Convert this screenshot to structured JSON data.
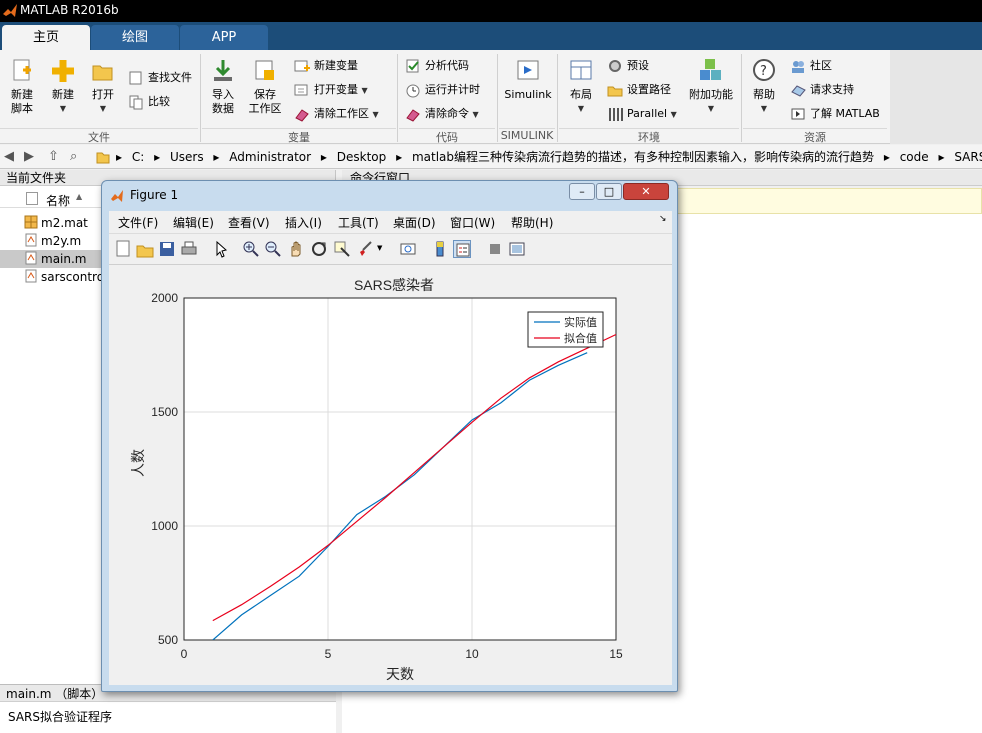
{
  "app": {
    "title": "MATLAB R2016b"
  },
  "tabs": [
    {
      "label": "主页"
    },
    {
      "label": "绘图"
    },
    {
      "label": "APP"
    }
  ],
  "ribbon": {
    "file": {
      "section": "文件",
      "new_script": "新建\n脚本",
      "new": "新建",
      "open": "打开",
      "find_files": "查找文件",
      "compare": "比较"
    },
    "variable": {
      "section": "变量",
      "import_data": "导入\n数据",
      "save_workspace": "保存\n工作区",
      "new_variable": "新建变量",
      "open_variable": "打开变量",
      "clear_workspace": "清除工作区"
    },
    "code": {
      "section": "代码",
      "analyze": "分析代码",
      "run_time": "运行并计时",
      "clear_commands": "清除命令"
    },
    "simulink": {
      "section": "SIMULINK",
      "simulink": "Simulink"
    },
    "environment": {
      "section": "环境",
      "layout": "布局",
      "preferences": "预设",
      "set_path": "设置路径",
      "parallel": "Parallel",
      "addons": "附加功能"
    },
    "resources": {
      "section": "资源",
      "help": "帮助",
      "community": "社区",
      "request_support": "请求支持",
      "learn_matlab": "了解 MATLAB"
    }
  },
  "address": {
    "path": [
      "C:",
      "Users",
      "Administrator",
      "Desktop",
      "matlab编程三种传染病流行趋势的描述，有多种控制因素输入，影响传染病的流行趋势",
      "code",
      "SARS程序"
    ]
  },
  "left_panel": {
    "title": "当前文件夹",
    "column": "名称",
    "files": [
      {
        "name": "m2.mat"
      },
      {
        "name": "m2y.m"
      },
      {
        "name": "main.m"
      },
      {
        "name": "sarscontro"
      }
    ],
    "detail_title": "main.m  （脚本）",
    "detail_text": "SARS拟合验证程序"
  },
  "command_window": {
    "title": "命令行窗口"
  },
  "figure": {
    "title": "Figure 1",
    "menus": [
      "文件(F)",
      "编辑(E)",
      "查看(V)",
      "插入(I)",
      "工具(T)",
      "桌面(D)",
      "窗口(W)",
      "帮助(H)"
    ]
  },
  "colors": {
    "actual": "#0072bd",
    "fitted": "#e8001c"
  },
  "chart_data": {
    "type": "line",
    "title": "SARS感染者",
    "xlabel": "天数",
    "ylabel": "人数",
    "xlim": [
      0,
      15
    ],
    "ylim": [
      500,
      2000
    ],
    "xticks": [
      0,
      5,
      10,
      15
    ],
    "yticks": [
      500,
      1000,
      1500,
      2000
    ],
    "grid": true,
    "legend_position": "top-right",
    "series": [
      {
        "name": "实际值",
        "x": [
          1,
          2,
          3,
          4,
          5,
          6,
          7,
          8,
          9,
          10,
          11,
          12,
          13,
          14
        ],
        "y": [
          500,
          610,
          695,
          780,
          910,
          1050,
          1130,
          1225,
          1345,
          1465,
          1540,
          1640,
          1705,
          1760
        ]
      },
      {
        "name": "拟合值",
        "x": [
          1,
          2,
          3,
          4,
          5,
          6,
          7,
          8,
          9,
          10,
          11,
          12,
          13,
          14,
          15
        ],
        "y": [
          585,
          655,
          735,
          820,
          915,
          1020,
          1125,
          1235,
          1345,
          1455,
          1560,
          1650,
          1720,
          1780,
          1840
        ]
      }
    ]
  }
}
